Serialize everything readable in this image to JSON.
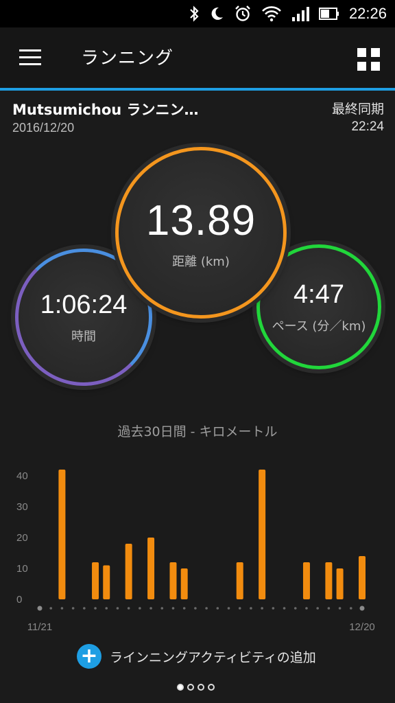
{
  "status": {
    "time": "22:26"
  },
  "appbar": {
    "title": "ランニング"
  },
  "activity": {
    "name": "Mutsumichou ランニン…",
    "date": "2016/12/20",
    "sync_label": "最終同期",
    "sync_time": "22:24"
  },
  "metrics": {
    "distance": {
      "value": "13.89",
      "label": "距離 (km)"
    },
    "time": {
      "value": "1:06:24",
      "label": "時間"
    },
    "pace": {
      "value": "4:47",
      "label": "ペース (分／km)"
    }
  },
  "colors": {
    "accent": "#1e9ee3",
    "distance": "#f4961e",
    "pace": "#21d63b",
    "time_top": "#4a8fe0",
    "time_bottom": "#7c5fc0",
    "bar": "#f28c0f"
  },
  "chart_title": "過去30日間 - キロメートル",
  "chart_data": {
    "type": "bar",
    "title": "過去30日間 - キロメートル",
    "y_ticks": [
      "0",
      "10",
      "20",
      "30",
      "40"
    ],
    "ylim": [
      0,
      42
    ],
    "x_start_label": "11/21",
    "x_end_label": "12/20",
    "values": [
      0,
      0,
      42,
      0,
      0,
      12,
      11,
      0,
      18,
      0,
      20,
      0,
      12,
      10,
      0,
      0,
      0,
      0,
      12,
      0,
      42,
      0,
      0,
      0,
      12,
      0,
      12,
      10,
      0,
      14
    ]
  },
  "add_activity_label": "ラインニングアクティビティの追加",
  "pager": {
    "count": 4,
    "active": 0
  }
}
